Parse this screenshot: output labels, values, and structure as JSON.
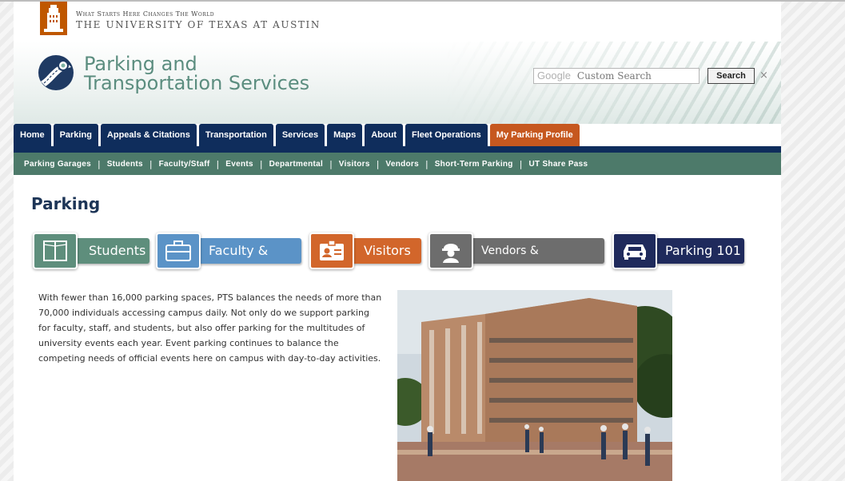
{
  "university": {
    "tagline": "What Starts Here Changes The World",
    "name": "THE UNIVERSITY OF TEXAS AT AUSTIN"
  },
  "site": {
    "title_line1": "Parking and",
    "title_line2": "Transportation Services"
  },
  "search": {
    "google_label": "Google",
    "placeholder": "Custom Search",
    "button_label": "Search",
    "clear_label": "×"
  },
  "nav": {
    "tabs": [
      {
        "label": "Home"
      },
      {
        "label": "Parking"
      },
      {
        "label": "Appeals & Citations"
      },
      {
        "label": "Transportation"
      },
      {
        "label": "Services"
      },
      {
        "label": "Maps"
      },
      {
        "label": "About"
      },
      {
        "label": "Fleet Operations"
      },
      {
        "label": "My Parking Profile"
      }
    ]
  },
  "subnav": {
    "items": [
      {
        "label": "Parking Garages"
      },
      {
        "label": "Students"
      },
      {
        "label": "Faculty/Staff"
      },
      {
        "label": "Events"
      },
      {
        "label": "Departmental"
      },
      {
        "label": "Visitors"
      },
      {
        "label": "Vendors"
      },
      {
        "label": "Short-Term Parking"
      },
      {
        "label": "UT Share Pass"
      }
    ],
    "separator": "|"
  },
  "main": {
    "title": "Parking",
    "categories": [
      {
        "label": "Students",
        "icon": "book-icon",
        "color": "#5e8e7c"
      },
      {
        "label": "Faculty & Staff",
        "icon": "briefcase-icon",
        "color": "#5b93c7"
      },
      {
        "label": "Visitors",
        "icon": "id-badge-icon",
        "color": "#d2662b"
      },
      {
        "label": "Vendors & Contractors",
        "icon": "hard-hat-worker-icon",
        "color": "#6d6d6d"
      },
      {
        "label": "Parking 101",
        "icon": "car-icon",
        "color": "#1f2a5c"
      }
    ],
    "body": "With fewer than 16,000 parking spaces, PTS balances the needs of more than 70,000 individuals accessing campus daily. Not only do we support parking for faculty, staff, and students, but also offer parking for the multitudes of university events each year. Event parking continues to balance the competing needs of official events here on campus with day-to-day activities."
  },
  "colors": {
    "ut_orange": "#bf5700",
    "nav_blue": "#0f2d5c",
    "subnav_green": "#4d7a6a",
    "profile_orange": "#c6581f"
  }
}
